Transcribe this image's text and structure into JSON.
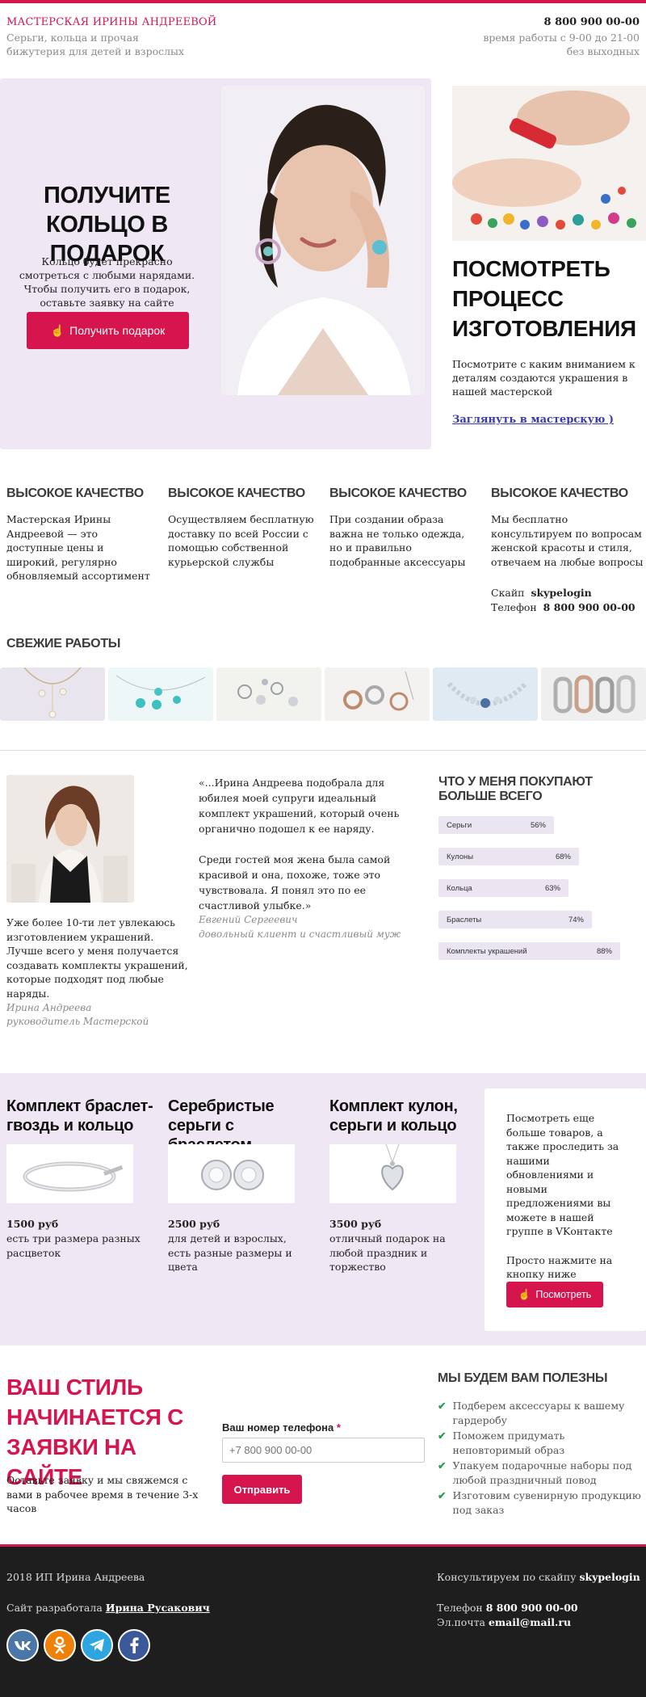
{
  "header": {
    "brand": "МАСТЕРСКАЯ ИРИНЫ АНДРЕЕВОЙ",
    "tagline": "Серьги, кольца и прочая бижутерия для детей и взрослых",
    "phone": "8 800 900 00-00",
    "hours_line1": "время работы с 9-00 до 21-00",
    "hours_line2": "без выходных"
  },
  "hero": {
    "title": "ПОЛУЧИТЕ КОЛЬЦО В ПОДАРОК",
    "text": "Кольцо будет прекрасно смотреться с любыми нарядами. Чтобы получить его в подарок, оставьте заявку на сайте",
    "button": "Получить подарок"
  },
  "process": {
    "title": "ПОСМОТРЕТЬ ПРОЦЕСС ИЗГОТОВЛЕНИЯ",
    "text": "Посмотрите с каким вниманием к деталям создаются украшения в нашей мастерской",
    "link": "Заглянуть в мастерскую )"
  },
  "features": [
    {
      "title": "ВЫСОКОЕ КАЧЕСТВО",
      "text": "Мастерская Ирины Андреевой — это доступные цены и широкий, регулярно обновляемый ассортимент"
    },
    {
      "title": "ВЫСОКОЕ КАЧЕСТВО",
      "text": "Осуществляем бесплатную доставку по всей России с помощью собственной курьерской службы"
    },
    {
      "title": "ВЫСОКОЕ КАЧЕСТВО",
      "text": "При создании образа важна не только одежда, но и правильно подобранные аксессуары"
    },
    {
      "title": "ВЫСОКОЕ КАЧЕСТВО",
      "text": "Мы бесплатно консультируем по вопросам женской красоты и стиля, отвечаем на любые вопросы"
    }
  ],
  "contacts": {
    "skype_label": "Скайп",
    "skype": "skypelogin",
    "phone_label": "Телефон",
    "phone": "8 800 900 00-00"
  },
  "works": {
    "title": "СВЕЖИЕ РАБОТЫ"
  },
  "about": {
    "text": "Уже более 10-ти лет увлекаюсь изготовлением украшений. Лучше всего у меня получается создавать комплекты украшений, которые подходят под любые наряды.",
    "name": "Ирина Андреева",
    "role": "руководитель Мастерской"
  },
  "testimonial": {
    "p1": "«...Ирина Андреева подобрала для юбилея моей супруги идеальный комплект украшений, который очень органично подошел к ее наряду.",
    "p2": "Среди гостей моя жена была самой красивой и она, похоже, тоже это чувствовала. Я понял это по ее счастливой улыбке.»",
    "name": "Евгений Сергеевич",
    "role": "довольный клиент и счастливый муж"
  },
  "sales": {
    "title": "ЧТО У МЕНЯ ПОКУПАЮТ БОЛЬШЕ ВСЕГО",
    "items": [
      {
        "label": "Серьги",
        "percent": "56%",
        "value": 56
      },
      {
        "label": "Кулоны",
        "percent": "68%",
        "value": 68
      },
      {
        "label": "Кольца",
        "percent": "63%",
        "value": 63
      },
      {
        "label": "Браслеты",
        "percent": "74%",
        "value": 74
      },
      {
        "label": "Комплекты украшений",
        "percent": "88%",
        "value": 88
      }
    ]
  },
  "products": [
    {
      "title": "Комплект браслет-гвоздь и кольцо",
      "price": "1500 руб",
      "desc": "есть три размера разных расцветок"
    },
    {
      "title": "Серебристые серьги с браслетом",
      "price": "2500 руб",
      "desc": "для детей и взрослых, есть разные размеры и цвета"
    },
    {
      "title": "Комплект кулон, серьги и кольцо",
      "price": "3500 руб",
      "desc": "отличный подарок на любой праздник и торжество"
    }
  ],
  "vk": {
    "text1": "Посмотреть еще больше товаров, а также проследить за нашими обновлениями и новыми предложениями вы можете в нашей группе в VKонтакте",
    "text2": "Просто нажмите на кнопку ниже",
    "button": "Посмотреть"
  },
  "cta": {
    "title": "ВАШ СТИЛЬ НАЧИНАЕТСЯ С ЗАЯВКИ НА САЙТЕ",
    "text": "Оставьте заявку и мы свяжемся с вами в рабочее время в течение 3-х часов",
    "label": "Ваш номер телефона",
    "required": "*",
    "placeholder": "+7 800 900 00-00",
    "button": "Отправить"
  },
  "benefits": {
    "title": "МЫ БУДЕМ ВАМ ПОЛЕЗНЫ",
    "items": [
      "Подберем аксессуары к вашему гардеробу",
      "Поможем придумать неповторимый образ",
      "Упакуем подарочные наборы под любой праздничный повод",
      "Изготовим сувенирную продукцию под заказ"
    ]
  },
  "footer": {
    "copyright": "2018 ИП Ирина Андреева",
    "dev_label": "Сайт разработала",
    "dev_name": "Ирина Русакович",
    "consult_label": "Консультируем по скайпу",
    "skype": "skypelogin",
    "phone_label": "Телефон",
    "phone": "8 800 900 00-00",
    "email_label": "Эл.почта",
    "email": "email@mail.ru"
  },
  "social": {
    "icons": [
      "vk-icon",
      "odnoklassniki-icon",
      "telegram-icon",
      "facebook-icon"
    ],
    "colors": [
      "#4a76a8",
      "#ee8208",
      "#2ca5e0",
      "#3b5998"
    ]
  },
  "colors": {
    "accent": "#d6154f",
    "lavender": "#efe8f4",
    "footer": "#1e1e1e"
  }
}
